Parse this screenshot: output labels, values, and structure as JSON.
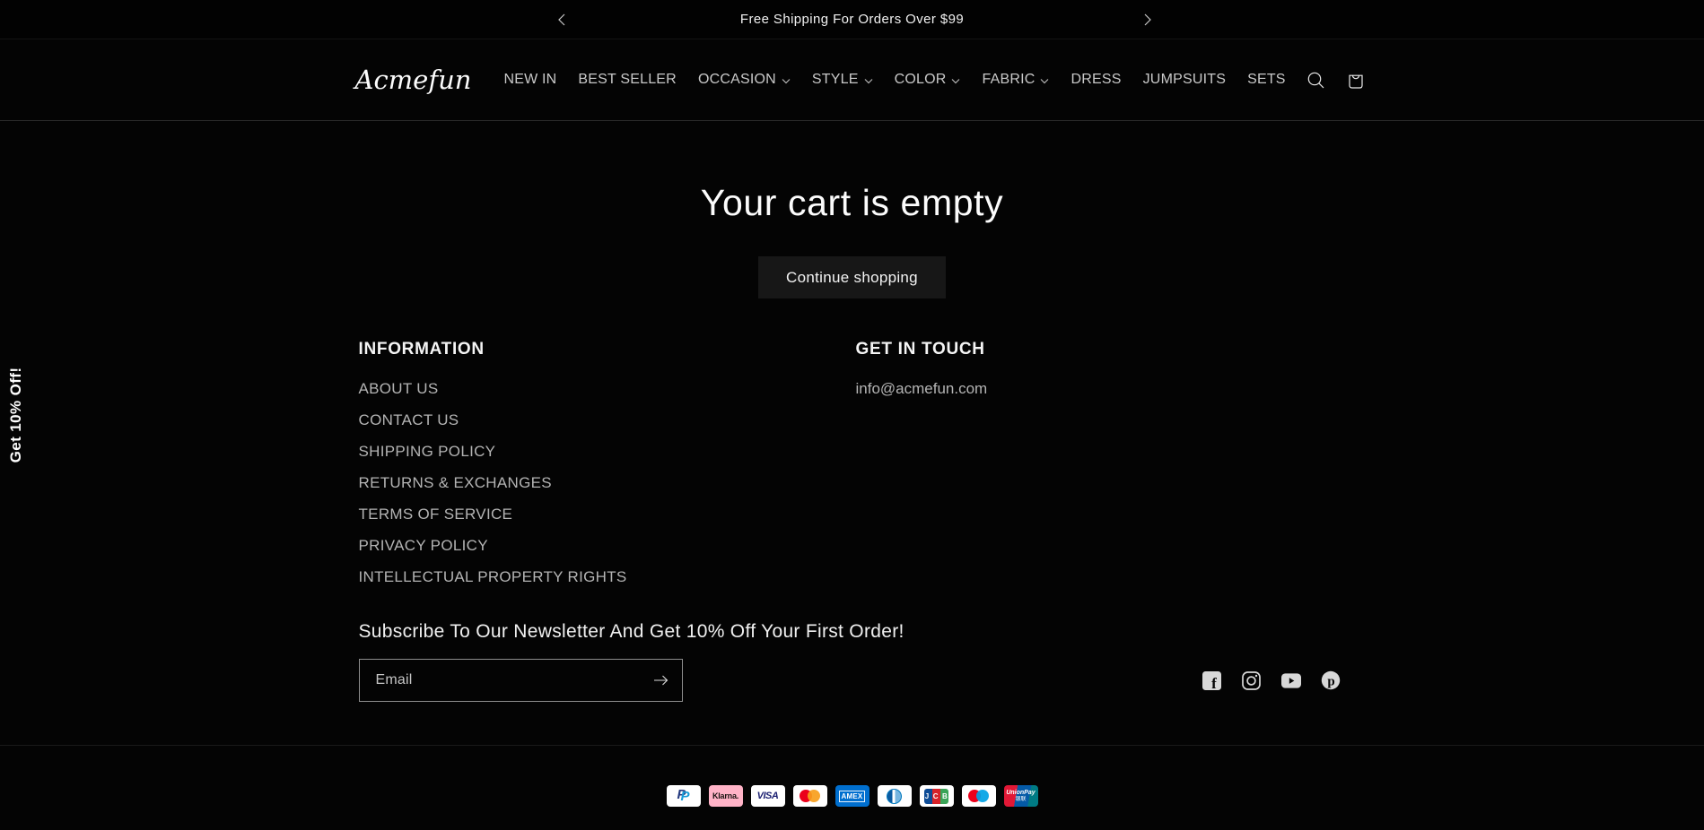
{
  "announcement": {
    "text": "Free Shipping For Orders Over $99"
  },
  "header": {
    "logo": "Acmefun",
    "nav": [
      {
        "label": "NEW IN"
      },
      {
        "label": "BEST SELLER"
      },
      {
        "label": "OCCASION",
        "dropdown": true
      },
      {
        "label": "STYLE",
        "dropdown": true
      },
      {
        "label": "COLOR",
        "dropdown": true
      },
      {
        "label": "FABRIC",
        "dropdown": true
      },
      {
        "label": "DRESS"
      },
      {
        "label": "JUMPSUITS"
      },
      {
        "label": "SETS"
      }
    ],
    "icons": [
      "search-icon",
      "cart-icon"
    ]
  },
  "cart": {
    "heading": "Your cart is empty",
    "continue_label": "Continue shopping"
  },
  "promo_tab": {
    "label": "Get 10% Off!"
  },
  "footer": {
    "information": {
      "title": "INFORMATION",
      "links": [
        "ABOUT US",
        "CONTACT US",
        "SHIPPING POLICY",
        "RETURNS & EXCHANGES",
        "TERMS OF SERVICE",
        "PRIVACY POLICY",
        "INTELLECTUAL PROPERTY RIGHTS"
      ]
    },
    "get_in_touch": {
      "title": "GET IN TOUCH",
      "email": "info@acmefun.com"
    },
    "newsletter": {
      "heading": "Subscribe To Our Newsletter And Get 10% Off Your First Order!",
      "placeholder": "Email"
    },
    "social": [
      "facebook",
      "instagram",
      "youtube",
      "pinterest"
    ],
    "social_glyphs": {
      "facebook": "f",
      "pinterest": "p"
    },
    "payments": {
      "methods": [
        "paypal",
        "klarna",
        "visa",
        "mastercard",
        "amex",
        "diners",
        "jcb",
        "maestro",
        "unionpay"
      ],
      "paypal_text": "P",
      "klarna_text": "Klarna.",
      "visa_text": "VISA",
      "amex_text": "AMEX",
      "jcb_text": "JCB",
      "unionpay_text": "UnionPay",
      "unionpay_cn": "银联"
    }
  },
  "colors": {
    "page_bg": "#040404",
    "text": "#ffffff",
    "muted_text": "#b4b4b4",
    "border": "rgba(255,255,255,0.15)",
    "button_bg": "#171717",
    "klarna_pink": "#ffb3c7",
    "amex_blue": "#006fcf",
    "visa_blue": "#1a1f71",
    "mastercard_red": "#eb001b",
    "mastercard_orange": "#f79e1b",
    "maestro_blue": "#00a2e5",
    "diners_blue": "#0079be",
    "paypal_navy": "#253b80",
    "paypal_cyan": "#179bd7",
    "jcb_blue": "#0e4c96",
    "jcb_red": "#d8232a",
    "jcb_green": "#3aa457",
    "unionpay_red": "#e21836",
    "unionpay_blue": "#045aa7",
    "unionpay_teal": "#007b84"
  }
}
